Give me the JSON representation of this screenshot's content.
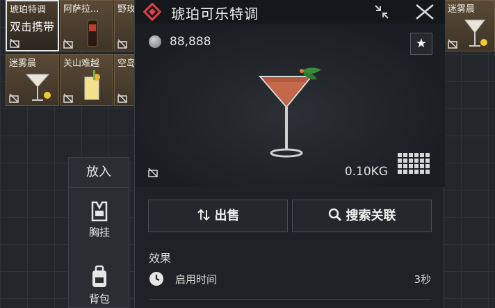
{
  "item": {
    "title": "琥珀可乐特调",
    "price": "88,888",
    "weight": "0.10KG",
    "sell_label": "出售",
    "search_label": "搜索关联",
    "effect_heading": "效果",
    "effect_label": "启用时间",
    "effect_value": "3秒"
  },
  "inventory": {
    "cells": [
      {
        "name": "琥珀特调",
        "tag": "双击携带"
      },
      {
        "name": "阿萨拉..."
      },
      {
        "name": "野玫"
      },
      {
        "name": "迷雾晨"
      },
      {
        "name": "关山难越"
      },
      {
        "name": "空岛"
      },
      {
        "name": "迷雾晨"
      }
    ]
  },
  "side": {
    "put_label": "放入",
    "slot1": "胸挂",
    "slot2": "背包"
  },
  "colors": {
    "accent_red": "#e0424c",
    "panel_bg": "#1e2125",
    "cell_tan": "#5a4a36"
  }
}
